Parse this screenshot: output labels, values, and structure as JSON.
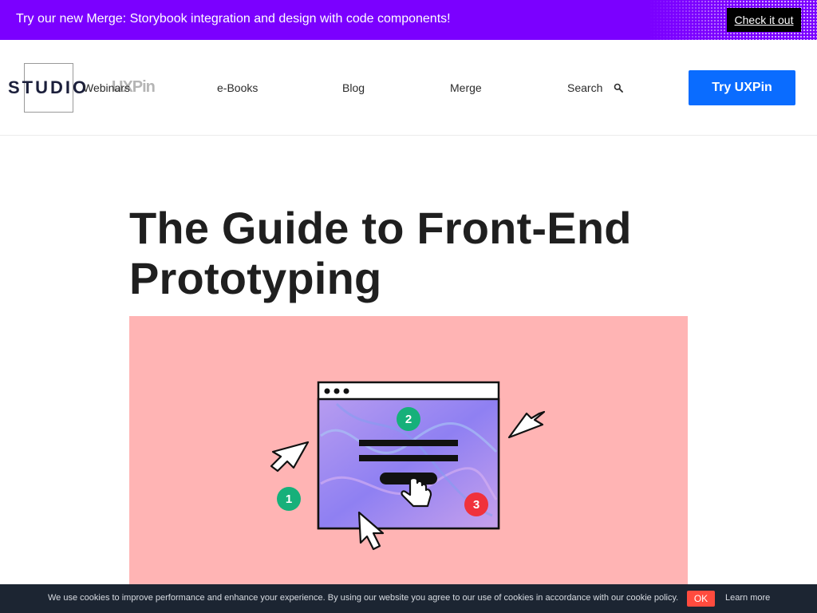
{
  "promo": {
    "text": "Try our new Merge: Storybook integration and design with code components!",
    "cta_label": "Check it out",
    "background": "#7b00ff"
  },
  "header": {
    "logo_studio": "STUDIO",
    "logo_uxpin": "UXPin",
    "nav": [
      "Webinars",
      "e-Books",
      "Blog",
      "Merge",
      "Search"
    ],
    "search_icon": "search-icon",
    "try_label": "Try UXPin",
    "try_color": "#0a6cff"
  },
  "article": {
    "title": "The Guide to Front-End Prototyping",
    "hero_background": "#ffb4b4",
    "hero_badges": [
      "1",
      "2",
      "3"
    ]
  },
  "cookie": {
    "text": "We use cookies to improve performance and enhance your experience. By using our website you agree to our use of cookies in accordance with our cookie policy.",
    "ok_label": "OK",
    "learn_label": "Learn more"
  }
}
